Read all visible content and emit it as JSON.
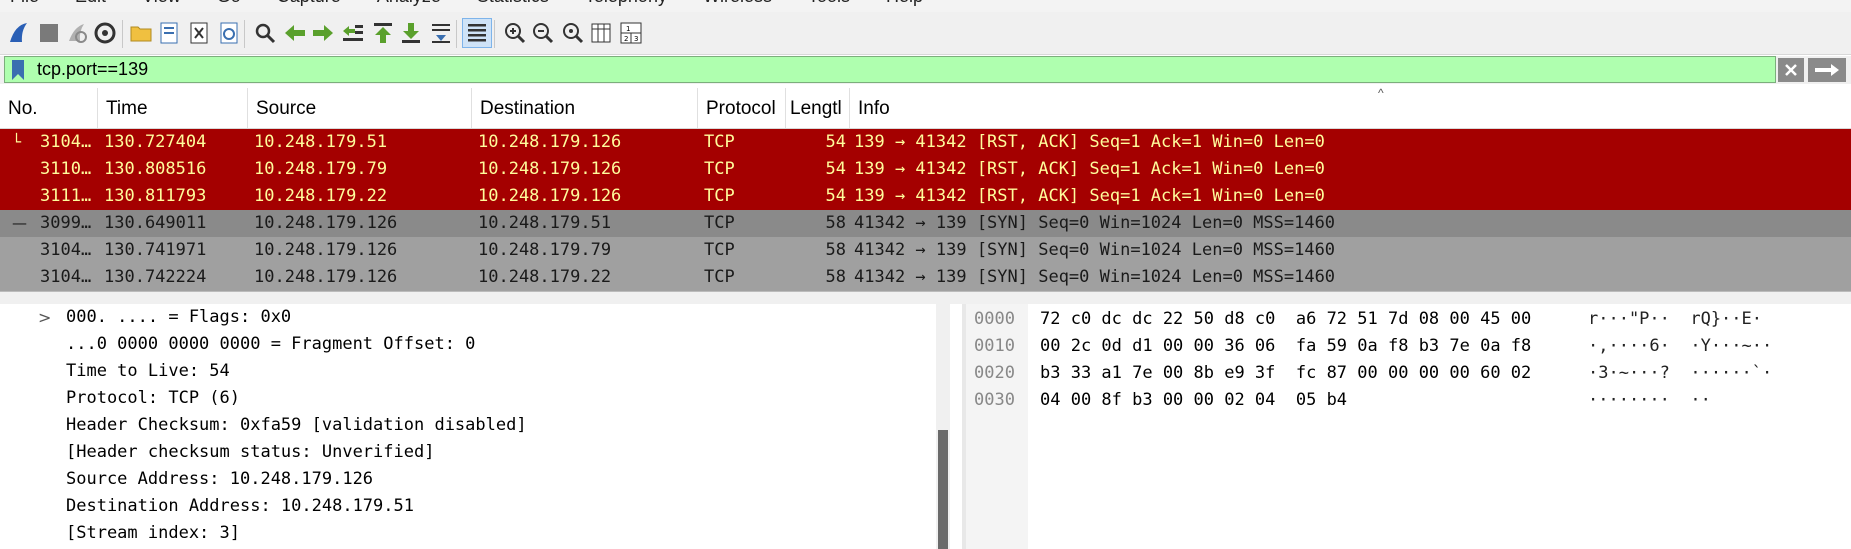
{
  "menu": [
    "File",
    "Edit",
    "View",
    "Go",
    "Capture",
    "Analyze",
    "Statistics",
    "Telephony",
    "Wireless",
    "Tools",
    "Help"
  ],
  "toolbar": {
    "icons": [
      "shark-fin-start-icon",
      "stop-capture-icon",
      "restart-capture-icon",
      "capture-options-icon",
      "open-file-icon",
      "save-file-icon",
      "close-file-icon",
      "reload-file-icon",
      "find-packet-icon",
      "go-back-icon",
      "go-forward-icon",
      "go-to-packet-icon",
      "go-first-icon",
      "go-last-icon",
      "autoscroll-icon",
      "colorize-icon",
      "zoom-in-icon",
      "zoom-out-icon",
      "zoom-normal-icon",
      "resize-columns-icon",
      "layout-icon"
    ]
  },
  "filter": {
    "value": "tcp.port==139",
    "bg_color": "#afffaf"
  },
  "packet_list": {
    "columns": [
      "No.",
      "Time",
      "Source",
      "Destination",
      "Protocol",
      "Lengtl",
      "Info"
    ],
    "rows": [
      {
        "no": "3104…",
        "time": "130.727404",
        "source": "10.248.179.51",
        "destination": "10.248.179.126",
        "protocol": "TCP",
        "length": "54",
        "info": "139 → 41342 [RST, ACK] Seq=1 Ack=1 Win=0 Len=0",
        "color": "red",
        "mark": "└"
      },
      {
        "no": "3110…",
        "time": "130.808516",
        "source": "10.248.179.79",
        "destination": "10.248.179.126",
        "protocol": "TCP",
        "length": "54",
        "info": "139 → 41342 [RST, ACK] Seq=1 Ack=1 Win=0 Len=0",
        "color": "red",
        "mark": ""
      },
      {
        "no": "3111…",
        "time": "130.811793",
        "source": "10.248.179.22",
        "destination": "10.248.179.126",
        "protocol": "TCP",
        "length": "54",
        "info": "139 → 41342 [RST, ACK] Seq=1 Ack=1 Win=0 Len=0",
        "color": "red",
        "mark": ""
      },
      {
        "no": "3099…",
        "time": "130.649011",
        "source": "10.248.179.126",
        "destination": "10.248.179.51",
        "protocol": "TCP",
        "length": "58",
        "info": "41342 → 139 [SYN] Seq=0 Win=1024 Len=0 MSS=1460",
        "color": "gray1",
        "mark": "—"
      },
      {
        "no": "3104…",
        "time": "130.741971",
        "source": "10.248.179.126",
        "destination": "10.248.179.79",
        "protocol": "TCP",
        "length": "58",
        "info": "41342 → 139 [SYN] Seq=0 Win=1024 Len=0 MSS=1460",
        "color": "gray2",
        "mark": ""
      },
      {
        "no": "3104…",
        "time": "130.742224",
        "source": "10.248.179.126",
        "destination": "10.248.179.22",
        "protocol": "TCP",
        "length": "58",
        "info": "41342 → 139 [SYN] Seq=0 Win=1024 Len=0 MSS=1460",
        "color": "gray2",
        "mark": ""
      }
    ],
    "row_colors": {
      "red": "#a40000",
      "gray1": "#8a8a8a",
      "gray2": "#a0a0a0"
    }
  },
  "details": {
    "lines": [
      "000. .... = Flags: 0x0",
      "...0 0000 0000 0000 = Fragment Offset: 0",
      "Time to Live: 54",
      "Protocol: TCP (6)",
      "Header Checksum: 0xfa59 [validation disabled]",
      "[Header checksum status: Unverified]",
      "Source Address: 10.248.179.126",
      "Destination Address: 10.248.179.51",
      "[Stream index: 3]"
    ],
    "expander": ">"
  },
  "bytes": {
    "rows": [
      {
        "offset": "0000",
        "hex": "72 c0 dc dc 22 50 d8 c0  a6 72 51 7d 08 00 45 00",
        "ascii": "r···\"P··  rQ}··E·"
      },
      {
        "offset": "0010",
        "hex": "00 2c 0d d1 00 00 36 06  fa 59 0a f8 b3 7e 0a f8",
        "ascii": "·,····6·  ·Y···~··"
      },
      {
        "offset": "0020",
        "hex": "b3 33 a1 7e 00 8b e9 3f  fc 87 00 00 00 00 60 02",
        "ascii": "·3·~···?  ······`·"
      },
      {
        "offset": "0030",
        "hex": "04 00 8f b3 00 00 02 04  05 b4",
        "ascii": "········  ··"
      }
    ]
  }
}
